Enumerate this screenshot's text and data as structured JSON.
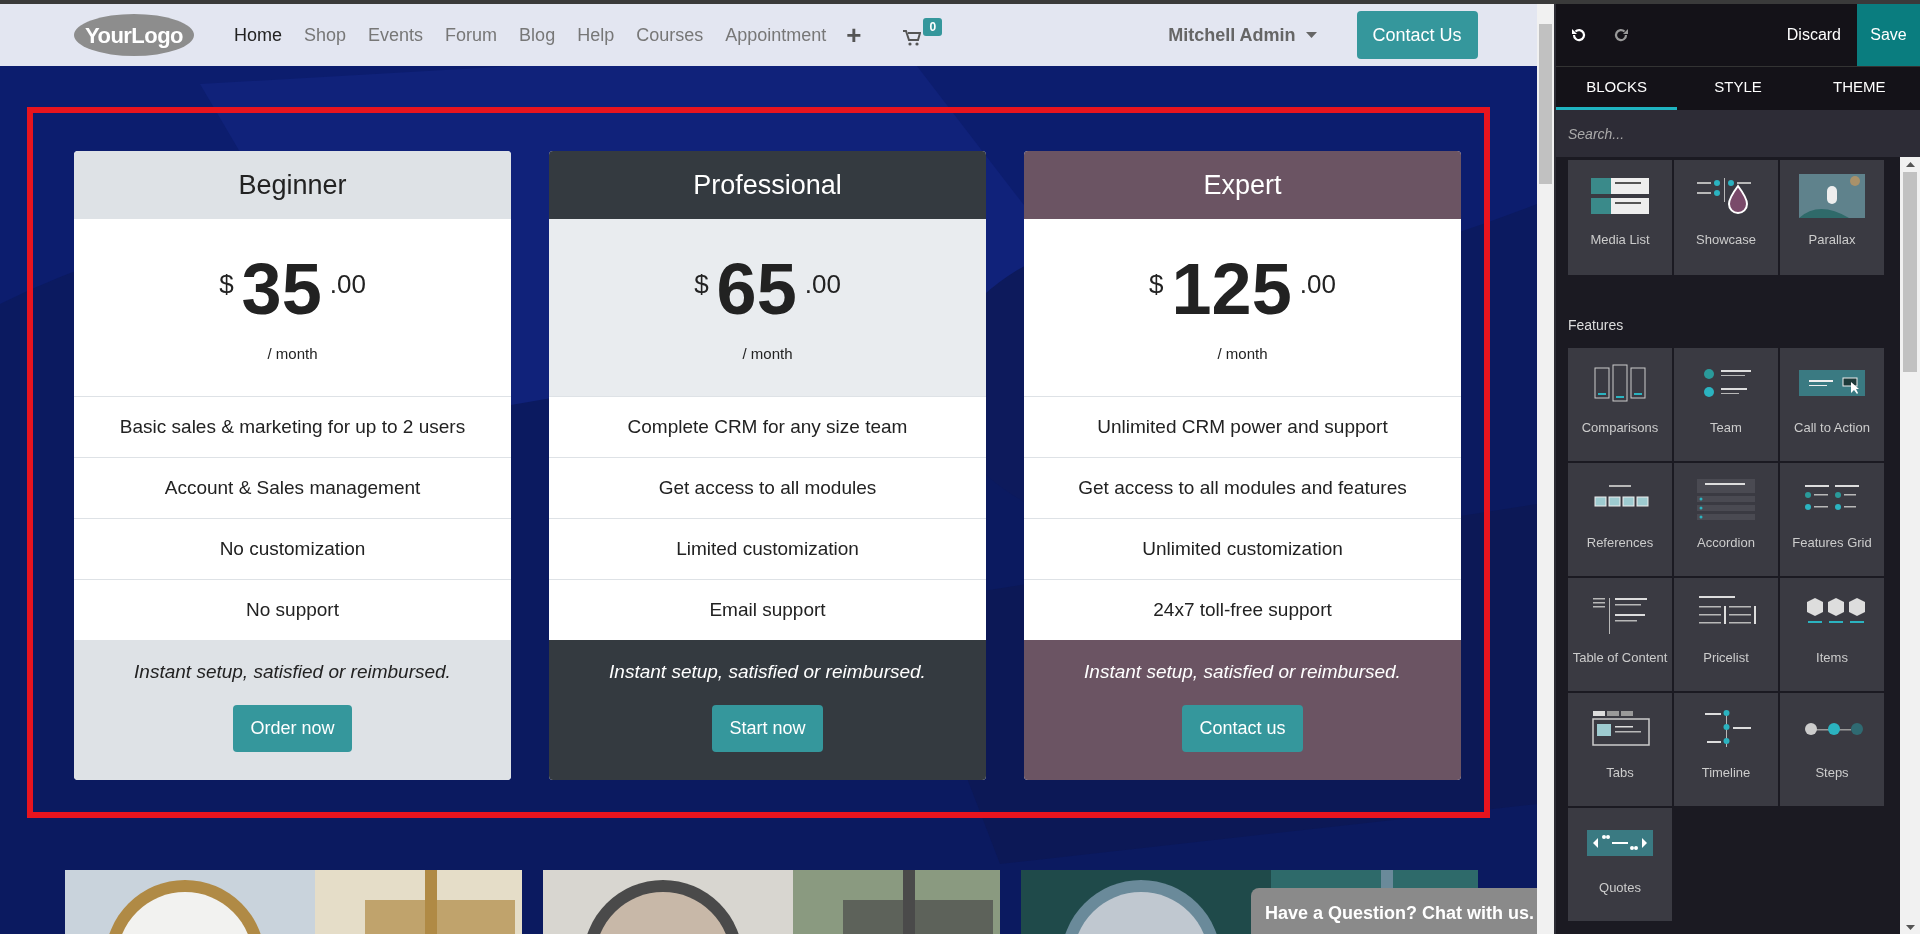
{
  "header": {
    "logo": "YourLogo",
    "nav": [
      {
        "label": "Home",
        "selected": true
      },
      {
        "label": "Shop",
        "selected": false
      },
      {
        "label": "Events",
        "selected": false
      },
      {
        "label": "Forum",
        "selected": false
      },
      {
        "label": "Blog",
        "selected": false
      },
      {
        "label": "Help",
        "selected": false
      },
      {
        "label": "Courses",
        "selected": false
      },
      {
        "label": "Appointment",
        "selected": false
      }
    ],
    "add": "+",
    "cart_count": "0",
    "user": "Mitchell Admin",
    "contact": "Contact Us"
  },
  "plans": [
    {
      "kind": "light",
      "name": "Beginner",
      "currency": "$",
      "amount": "35",
      "cents": ".00",
      "period": "/ month",
      "features": [
        "Basic sales & marketing for up to 2 users",
        "Account & Sales management",
        "No customization",
        "No support"
      ],
      "note": "Instant setup, satisfied or reimbursed.",
      "button": "Order now"
    },
    {
      "kind": "dark",
      "name": "Professional",
      "currency": "$",
      "amount": "65",
      "cents": ".00",
      "period": "/ month",
      "features": [
        "Complete CRM for any size team",
        "Get access to all modules",
        "Limited customization",
        "Email support"
      ],
      "note": "Instant setup, satisfied or reimbursed.",
      "button": "Start now"
    },
    {
      "kind": "mauve",
      "name": "Expert",
      "currency": "$",
      "amount": "125",
      "cents": ".00",
      "period": "/ month",
      "features": [
        "Unlimited CRM power and support",
        "Get access to all modules and features",
        "Unlimited customization",
        "24x7 toll-free support"
      ],
      "note": "Instant setup, satisfied or reimbursed.",
      "button": "Contact us"
    }
  ],
  "chat": "Have a Question? Chat with us.",
  "editor": {
    "discard": "Discard",
    "save": "Save",
    "tabs": [
      {
        "label": "BLOCKS",
        "selected": true
      },
      {
        "label": "STYLE",
        "selected": false
      },
      {
        "label": "THEME",
        "selected": false
      }
    ],
    "search": {
      "placeholder": "Search..."
    },
    "groups": [
      {
        "blocks": [
          {
            "kind": "medialist",
            "label": "Media List"
          },
          {
            "kind": "showcase",
            "label": "Showcase"
          },
          {
            "kind": "parallax",
            "label": "Parallax"
          }
        ]
      },
      {
        "heading": "Features",
        "blocks": [
          {
            "kind": "comparisons",
            "label": "Comparisons"
          },
          {
            "kind": "team",
            "label": "Team"
          },
          {
            "kind": "cta",
            "label": "Call to Action"
          },
          {
            "kind": "references",
            "label": "References"
          },
          {
            "kind": "accordion",
            "label": "Accordion"
          },
          {
            "kind": "featuresgrid",
            "label": "Features Grid"
          },
          {
            "kind": "toc",
            "label": "Table of Content"
          },
          {
            "kind": "pricelist",
            "label": "Pricelist"
          },
          {
            "kind": "items",
            "label": "Items"
          },
          {
            "kind": "tabs",
            "label": "Tabs"
          },
          {
            "kind": "timeline",
            "label": "Timeline"
          },
          {
            "kind": "steps",
            "label": "Steps"
          },
          {
            "kind": "quotes",
            "label": "Quotes"
          }
        ]
      }
    ]
  }
}
